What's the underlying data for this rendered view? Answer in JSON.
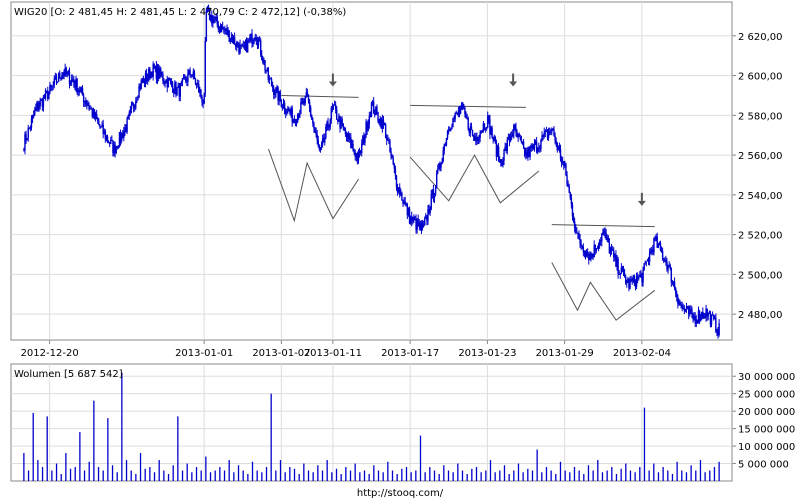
{
  "chart_data": [
    {
      "type": "candlestick",
      "header": "WIG20 [O: 2 481,45  H: 2 481,45  L: 2 470,79  C: 2 472,12] (-0,38%)",
      "series": [
        {
          "name": "WIG20",
          "color": "#0000cc"
        }
      ],
      "x_ticks": [
        "2012-12-20",
        "2013-01-01",
        "2013-01-07",
        "2013-01-11",
        "2013-01-17",
        "2013-01-23",
        "2013-01-29",
        "2013-02-04"
      ],
      "y_ticks": [
        2480,
        2500,
        2520,
        2540,
        2560,
        2580,
        2600,
        2620
      ],
      "y_tick_labels": [
        "2 480,00",
        "2 500,00",
        "2 520,00",
        "2 540,00",
        "2 560,00",
        "2 580,00",
        "2 600,00",
        "2 620,00"
      ],
      "ylim": [
        2467,
        2637
      ],
      "close_path": [
        [
          "2012-12-18",
          2566
        ],
        [
          "2012-12-19",
          2584
        ],
        [
          "2012-12-20",
          2592
        ],
        [
          "2012-12-21",
          2602
        ],
        [
          "2012-12-22",
          2596
        ],
        [
          "2012-12-23",
          2585
        ],
        [
          "2012-12-24",
          2573
        ],
        [
          "2012-12-25",
          2563
        ],
        [
          "2012-12-26",
          2575
        ],
        [
          "2012-12-27",
          2595
        ],
        [
          "2012-12-28",
          2603
        ],
        [
          "2012-12-29",
          2598
        ],
        [
          "2012-12-30",
          2592
        ],
        [
          "2012-12-31",
          2602
        ],
        [
          "2013-01-01",
          2586
        ],
        [
          "2013-01-01",
          2632
        ],
        [
          "2013-01-02",
          2626
        ],
        [
          "2013-01-03",
          2620
        ],
        [
          "2013-01-04",
          2612
        ],
        [
          "2013-01-05",
          2622
        ],
        [
          "2013-01-06",
          2598
        ],
        [
          "2013-01-07",
          2587
        ],
        [
          "2013-01-08",
          2578
        ],
        [
          "2013-01-09",
          2589
        ],
        [
          "2013-01-10",
          2560
        ],
        [
          "2013-01-11",
          2584
        ],
        [
          "2013-01-12",
          2570
        ],
        [
          "2013-01-13",
          2558
        ],
        [
          "2013-01-14",
          2585
        ],
        [
          "2013-01-15",
          2574
        ],
        [
          "2013-01-16",
          2545
        ],
        [
          "2013-01-17",
          2528
        ],
        [
          "2013-01-18",
          2522
        ],
        [
          "2013-01-19",
          2546
        ],
        [
          "2013-01-20",
          2575
        ],
        [
          "2013-01-21",
          2583
        ],
        [
          "2013-01-22",
          2568
        ],
        [
          "2013-01-23",
          2578
        ],
        [
          "2013-01-24",
          2556
        ],
        [
          "2013-01-25",
          2573
        ],
        [
          "2013-01-26",
          2560
        ],
        [
          "2013-01-27",
          2566
        ],
        [
          "2013-01-28",
          2573
        ],
        [
          "2013-01-29",
          2553
        ],
        [
          "2013-01-30",
          2518
        ],
        [
          "2013-01-31",
          2509
        ],
        [
          "2013-02-01",
          2521
        ],
        [
          "2013-02-02",
          2505
        ],
        [
          "2013-02-03",
          2495
        ],
        [
          "2013-02-04",
          2499
        ],
        [
          "2013-02-05",
          2517
        ],
        [
          "2013-02-06",
          2505
        ],
        [
          "2013-02-07",
          2484
        ],
        [
          "2013-02-08",
          2478
        ],
        [
          "2013-02-09",
          2481
        ],
        [
          "2013-02-10",
          2472
        ]
      ],
      "annotations": {
        "resistance_lines": [
          {
            "from": [
              "2013-01-07",
              2590
            ],
            "to": [
              "2013-01-13",
              2589
            ]
          },
          {
            "from": [
              "2013-01-17",
              2585
            ],
            "to": [
              "2013-01-26",
              2584
            ]
          },
          {
            "from": [
              "2013-01-28",
              2525
            ],
            "to": [
              "2013-02-05",
              2524
            ]
          }
        ],
        "pattern_lines": [
          [
            [
              "2013-01-06",
              2563
            ],
            [
              "2013-01-08",
              2527
            ],
            [
              "2013-01-09",
              2556
            ],
            [
              "2013-01-11",
              2528
            ],
            [
              "2013-01-13",
              2548
            ]
          ],
          [
            [
              "2013-01-17",
              2559
            ],
            [
              "2013-01-20",
              2537
            ],
            [
              "2013-01-22",
              2560
            ],
            [
              "2013-01-24",
              2536
            ],
            [
              "2013-01-27",
              2552
            ]
          ],
          [
            [
              "2013-01-28",
              2506
            ],
            [
              "2013-01-30",
              2482
            ],
            [
              "2013-01-31",
              2496
            ],
            [
              "2013-02-02",
              2477
            ],
            [
              "2013-02-05",
              2492
            ]
          ]
        ],
        "arrows_down": [
          [
            "2013-01-11",
            2597
          ],
          [
            "2013-01-25",
            2597
          ],
          [
            "2013-02-04",
            2537
          ]
        ]
      }
    },
    {
      "type": "bar",
      "header": "Wolumen [5 687 542]",
      "y_ticks": [
        5000000,
        10000000,
        15000000,
        20000000,
        25000000,
        30000000
      ],
      "y_tick_labels": [
        "5 000 000",
        "10 000 000",
        "15 000 000",
        "20 000 000",
        "25 000 000",
        "30 000 000"
      ],
      "ylim": [
        0,
        33500000
      ],
      "x_ticks": [
        "2012-12-20",
        "2013-01-01",
        "2013-01-07",
        "2013-01-11",
        "2013-01-17",
        "2013-01-23",
        "2013-01-29",
        "2013-02-04"
      ],
      "values": [
        8000000,
        3000000,
        19500000,
        6000000,
        4000000,
        18500000,
        3000000,
        5000000,
        2000000,
        8000000,
        3500000,
        4000000,
        14000000,
        3000000,
        5500000,
        23000000,
        4000000,
        3000000,
        18000000,
        4500000,
        2500000,
        31000000,
        6000000,
        3000000,
        2000000,
        8000000,
        3500000,
        4000000,
        2500000,
        6000000,
        3000000,
        2000000,
        4500000,
        18500000,
        3000000,
        5000000,
        2500000,
        4000000,
        3000000,
        7000000,
        2500000,
        3000000,
        4000000,
        3000000,
        6000000,
        2500000,
        4500000,
        3000000,
        2000000,
        5500000,
        3000000,
        2500000,
        4000000,
        25000000,
        3000000,
        6000000,
        2500000,
        4000000,
        3500000,
        2000000,
        5000000,
        3000000,
        2500000,
        4500000,
        3000000,
        6000000,
        2500000,
        3500000,
        2000000,
        4000000,
        3000000,
        5000000,
        2500000,
        3000000,
        2000000,
        4500000,
        3000000,
        2500000,
        5500000,
        3000000,
        2000000,
        3500000,
        4000000,
        2500000,
        3000000,
        13000000,
        2500000,
        4000000,
        3000000,
        2000000,
        4500000,
        3000000,
        2500000,
        5000000,
        3000000,
        2000000,
        3500000,
        4000000,
        2500000,
        3000000,
        6000000,
        2500000,
        3000000,
        4500000,
        2000000,
        3000000,
        5000000,
        2500000,
        3500000,
        3000000,
        9000000,
        2500000,
        4000000,
        3000000,
        2000000,
        5500000,
        3000000,
        2500000,
        4000000,
        3000000,
        2000000,
        4500000,
        3000000,
        6000000,
        2500000,
        3000000,
        4000000,
        2000000,
        3500000,
        5000000,
        3000000,
        2500000,
        4000000,
        21000000,
        3000000,
        5000000,
        2500000,
        4000000,
        3000000,
        2000000,
        5500000,
        3000000,
        2500000,
        4500000,
        3000000,
        6000000,
        2500000,
        3000000,
        4000000,
        5500000
      ]
    }
  ],
  "footer": {
    "url": "http://stooq.com/"
  },
  "colors": {
    "series": "#0000cc",
    "grid": "#dddddd",
    "axis": "#888888",
    "annotation": "#555555",
    "background": "#ffffff"
  }
}
